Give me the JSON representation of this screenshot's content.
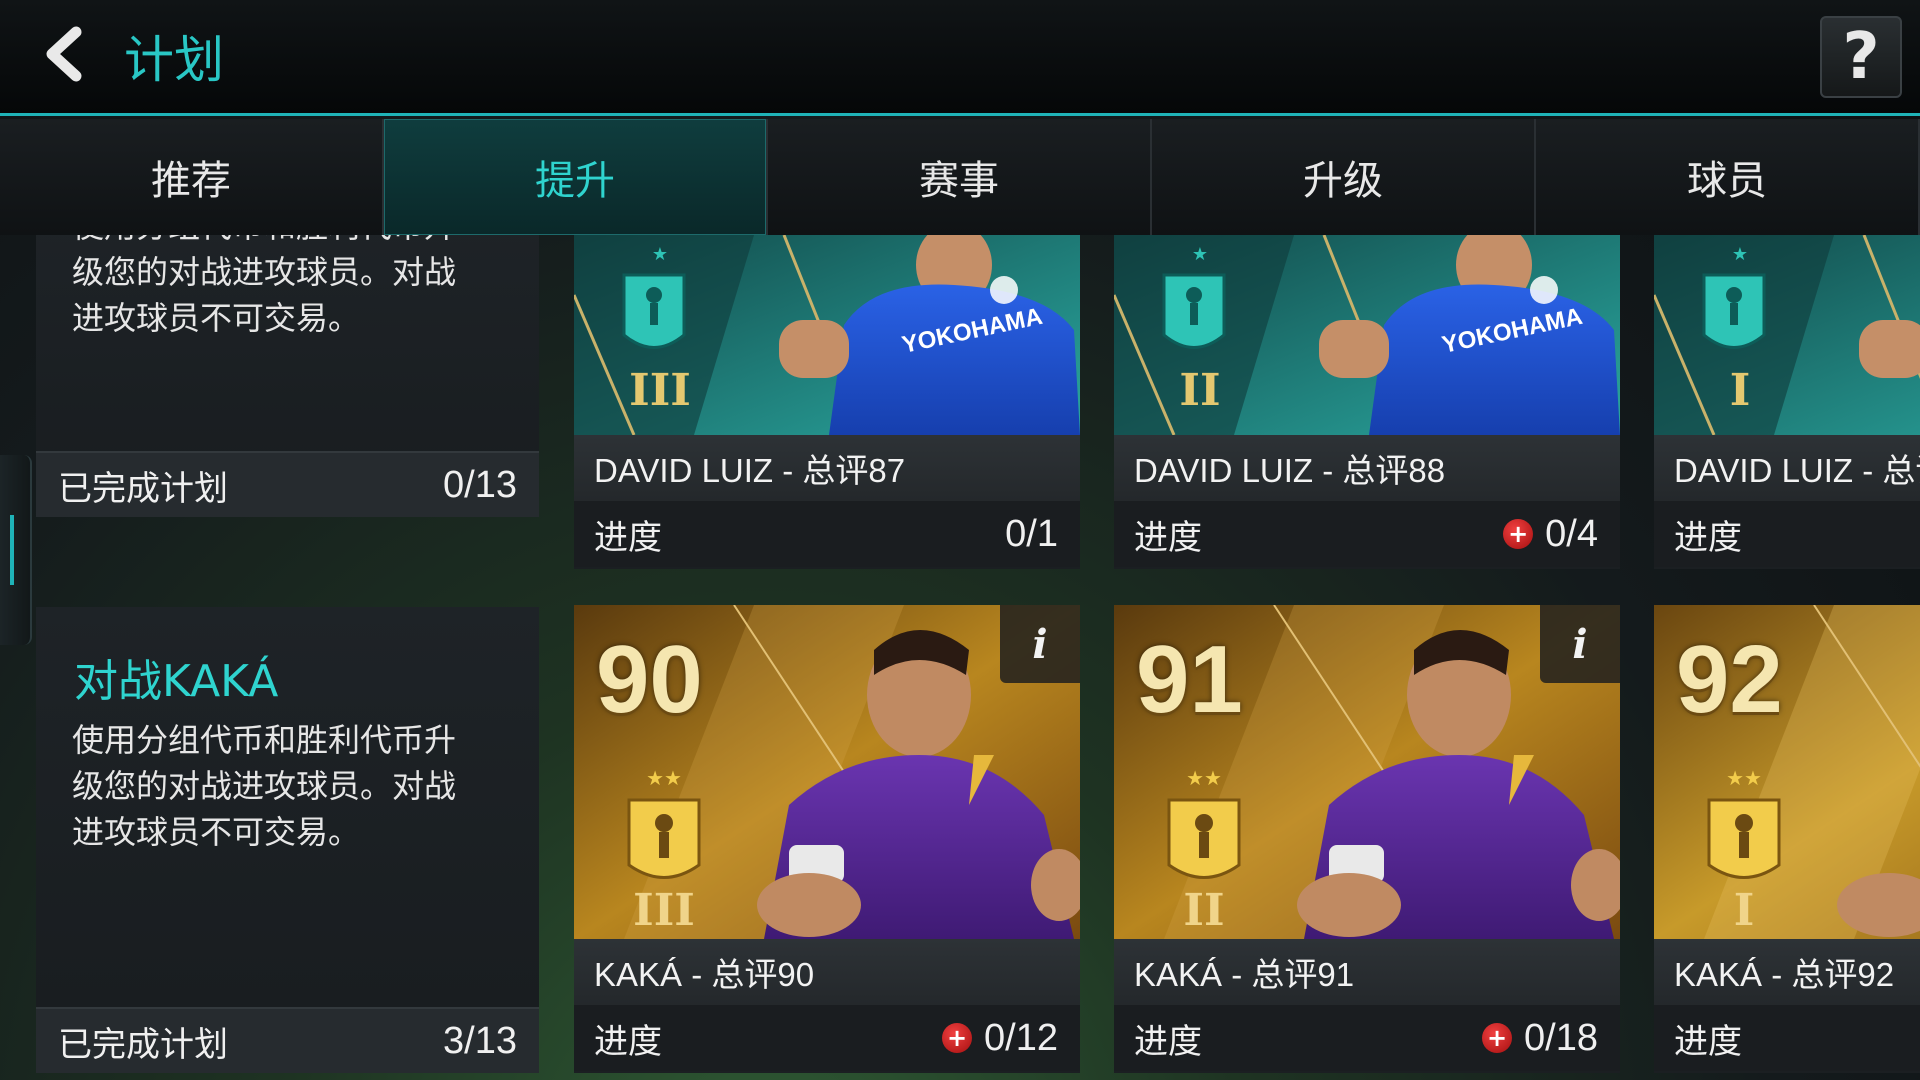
{
  "header": {
    "title": "计划",
    "back_icon": "chevron-left-icon",
    "help_label": "?"
  },
  "tabs": [
    {
      "label": "推荐",
      "active": false
    },
    {
      "label": "提升",
      "active": true
    },
    {
      "label": "赛事",
      "active": false
    },
    {
      "label": "升级",
      "active": false
    },
    {
      "label": "球员",
      "active": false
    }
  ],
  "sections": [
    {
      "title": "",
      "desc_lines": [
        "使用分组代币和胜利代币升",
        "级您的对战进攻球员。对战",
        "进攻球员不可交易。"
      ],
      "footer_label": "已完成计划",
      "footer_value": "0/13",
      "cards": [
        {
          "name": "DAVID LUIZ - 总评87",
          "progress_label": "进度",
          "progress_value": "0/1",
          "plus": false,
          "tier": "III",
          "stars": 1
        },
        {
          "name": "DAVID LUIZ - 总评88",
          "progress_label": "进度",
          "progress_value": "0/4",
          "plus": true,
          "tier": "II",
          "stars": 1
        },
        {
          "name": "DAVID LUIZ - 总评",
          "progress_label": "进度",
          "progress_value": "",
          "plus": false,
          "tier": "I",
          "stars": 1
        }
      ]
    },
    {
      "title": "对战KAKÁ",
      "desc_lines": [
        "使用分组代币和胜利代币升",
        "级您的对战进攻球员。对战",
        "进攻球员不可交易。"
      ],
      "footer_label": "已完成计划",
      "footer_value": "3/13",
      "cards": [
        {
          "name": "KAKÁ - 总评90",
          "rating": "90",
          "progress_label": "进度",
          "progress_value": "0/12",
          "plus": true,
          "tier": "III",
          "stars": 2,
          "info": "i"
        },
        {
          "name": "KAKÁ - 总评91",
          "rating": "91",
          "progress_label": "进度",
          "progress_value": "0/18",
          "plus": true,
          "tier": "II",
          "stars": 2,
          "info": "i"
        },
        {
          "name": "KAKÁ - 总评92",
          "rating": "92",
          "progress_label": "进度",
          "progress_value": "",
          "plus": false,
          "tier": "I",
          "stars": 2
        }
      ]
    }
  ],
  "colors": {
    "accent": "#2fd4cf",
    "teal_card": "#1f8f8a",
    "gold_card": "#b8861f",
    "chelsea_blue": "#1b4fd0",
    "orlando_purple": "#5b2a9a",
    "plus_red": "#d02020"
  }
}
